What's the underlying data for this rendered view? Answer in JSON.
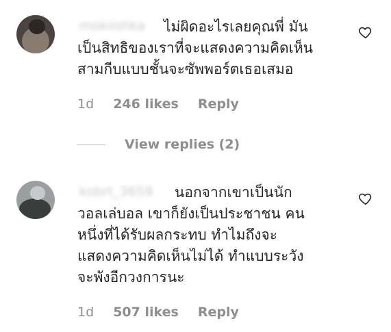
{
  "comments": [
    {
      "username": "mokiishka",
      "text": "ไม่ผิดอะไรเลยคุณพี่ มัน\nเป็นสิทธิของเราที่จะแสดงความคิดเห็น\nสามกีบแบบชั้นจะซัพพอร์ตเธอเสมอ",
      "time": "1d",
      "likes": "246 likes",
      "reply_label": "Reply",
      "view_replies": "View replies (2)"
    },
    {
      "username": "kobrt_3659",
      "text": "นอกจากเขาเป็นนัก\nวอลเล่บอล เขาก็ยังเป็นประชาชน คน\nหนึ่งที่ได้รับผลกระทบ ทำไมถึงจะ\nแสดงความคิดเห็นไม่ได้ ทำแบบระวัง\nจะพังอีกวงการนะ",
      "time": "1d",
      "likes": "507 likes",
      "reply_label": "Reply"
    }
  ],
  "icons": {
    "like": "heart-outline-icon"
  },
  "colors": {
    "text": "#262626",
    "muted": "#8e8e8e",
    "divider": "#c7c7c7"
  }
}
